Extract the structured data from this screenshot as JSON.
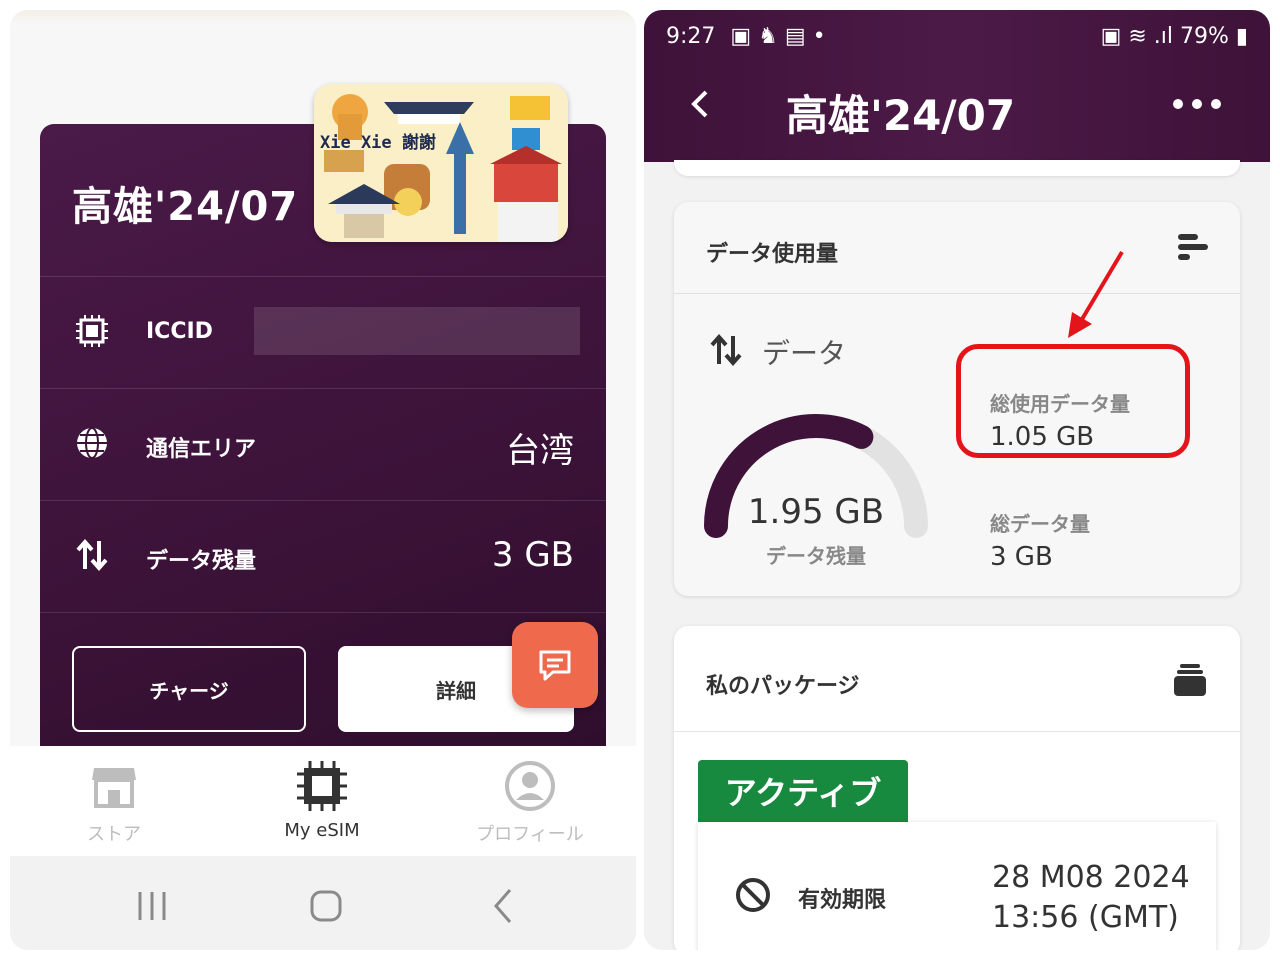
{
  "left": {
    "card": {
      "title": "高雄'24/07",
      "sim_art_text": "Xie Xie 謝謝",
      "rows": [
        {
          "icon": "chip-icon",
          "label": "ICCID",
          "value": ""
        },
        {
          "icon": "globe-icon",
          "label": "通信エリア",
          "value": "台湾"
        },
        {
          "icon": "data-arrows-icon",
          "label": "データ残量",
          "value": "3 GB"
        }
      ],
      "charge_label": "チャージ",
      "detail_label": "詳細"
    },
    "bottom_nav": [
      {
        "icon": "store-icon",
        "label": "ストア",
        "active": false
      },
      {
        "icon": "esim-chip-icon",
        "label": "My eSIM",
        "active": true
      },
      {
        "icon": "profile-icon",
        "label": "プロフィール",
        "active": false
      }
    ],
    "colors": {
      "card": "#3b1238",
      "fab": "#ef6a4c"
    }
  },
  "right": {
    "status_bar": {
      "time": "9:27",
      "battery": "79%"
    },
    "app_bar": {
      "title": "高雄'24/07"
    },
    "usage": {
      "title": "データ使用量",
      "data_label": "データ",
      "remaining_value": "1.95 GB",
      "remaining_label": "データ残量",
      "remaining_fraction": 0.65,
      "used_label": "総使用データ量",
      "used_value": "1.05 GB",
      "total_label": "総データ量",
      "total_value": "3 GB"
    },
    "package": {
      "title": "私のパッケージ",
      "status": "アクティブ",
      "expiry_label": "有効期限",
      "expiry_date": "28 M08 2024",
      "expiry_time": "13:56 (GMT)"
    },
    "colors": {
      "appbar": "#4c1a47",
      "highlight": "#e3151b",
      "active": "#178a3f"
    }
  }
}
